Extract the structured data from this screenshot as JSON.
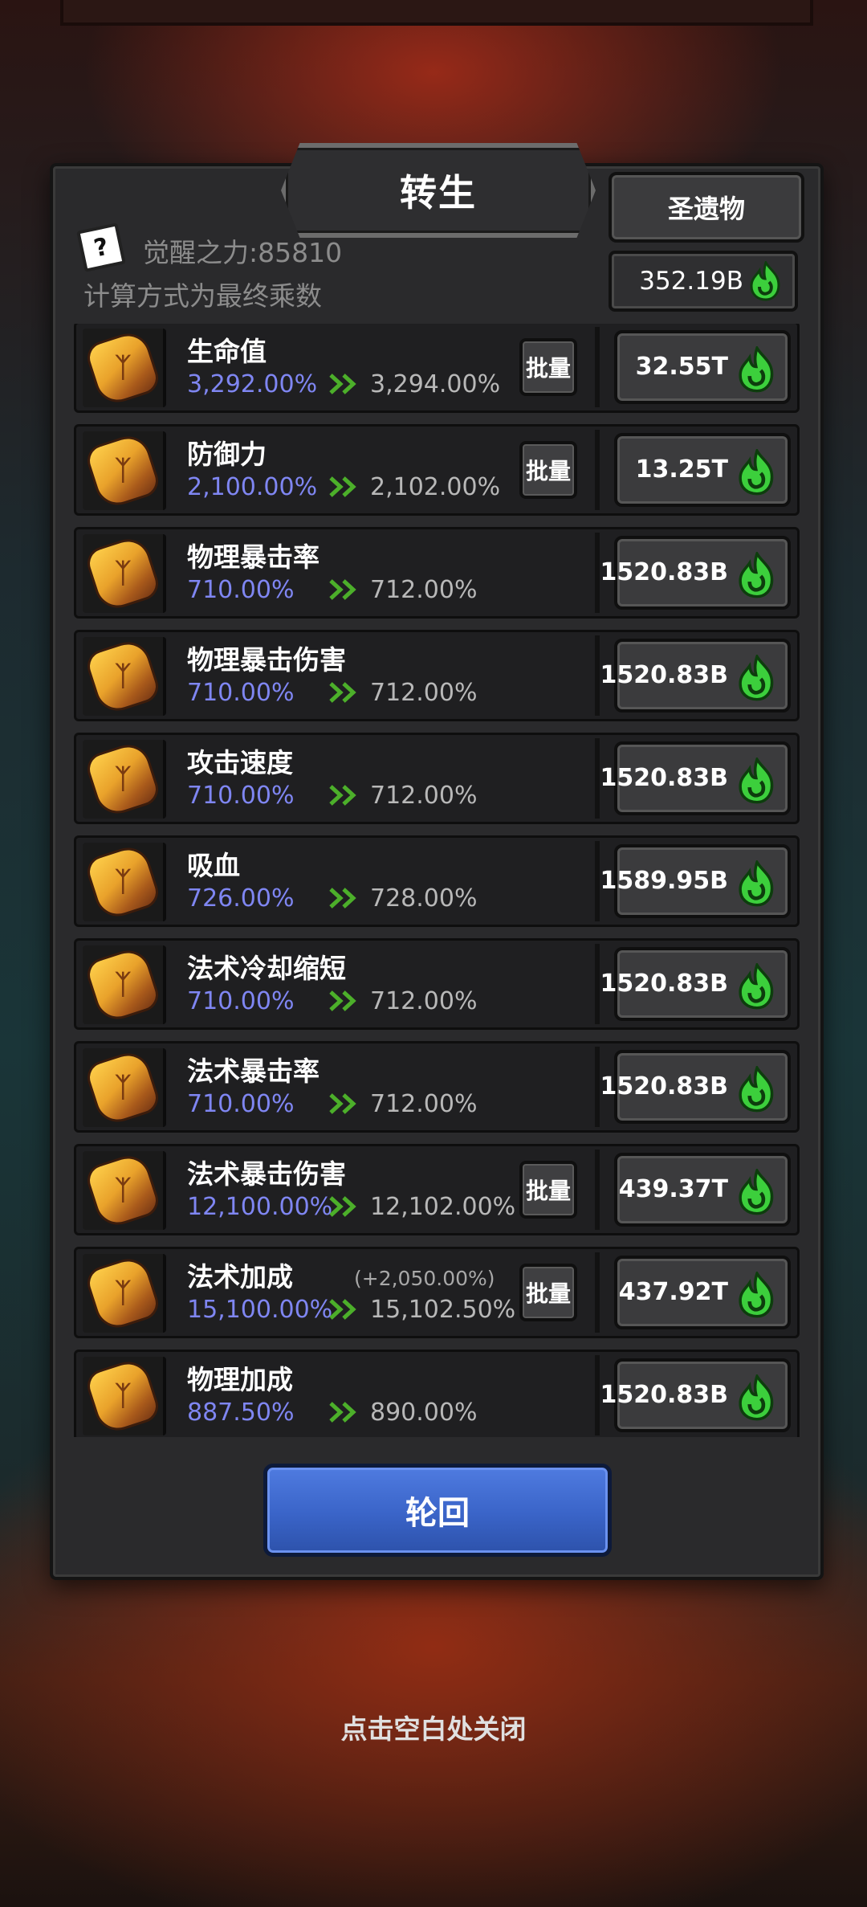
{
  "dialog": {
    "title": "转生",
    "relic_button": "圣遗物",
    "relic_amount": "352.19B",
    "help_icon_glyph": "?",
    "awaken_power": "觉醒之力:85810",
    "calc_note": "计算方式为最终乘数"
  },
  "stats": [
    {
      "name": "生命值",
      "current": "3,292.00%",
      "next": "3,294.00%",
      "batch": "批量",
      "cost": "32.55T"
    },
    {
      "name": "防御力",
      "current": "2,100.00%",
      "next": "2,102.00%",
      "batch": "批量",
      "cost": "13.25T"
    },
    {
      "name": "物理暴击率",
      "current": "710.00%",
      "next": "712.00%",
      "cost": "1520.83B"
    },
    {
      "name": "物理暴击伤害",
      "current": "710.00%",
      "next": "712.00%",
      "cost": "1520.83B"
    },
    {
      "name": "攻击速度",
      "current": "710.00%",
      "next": "712.00%",
      "cost": "1520.83B"
    },
    {
      "name": "吸血",
      "current": "726.00%",
      "next": "728.00%",
      "cost": "1589.95B"
    },
    {
      "name": "法术冷却缩短",
      "current": "710.00%",
      "next": "712.00%",
      "cost": "1520.83B"
    },
    {
      "name": "法术暴击率",
      "current": "710.00%",
      "next": "712.00%",
      "cost": "1520.83B"
    },
    {
      "name": "法术暴击伤害",
      "current": "12,100.00%",
      "next": "12,102.00%",
      "batch": "批量",
      "cost": "439.37T"
    },
    {
      "name": "法术加成",
      "extra": "(+2,050.00%)",
      "current": "15,100.00%",
      "next": "15,102.50%",
      "batch": "批量",
      "cost": "437.92T"
    },
    {
      "name": "物理加成",
      "current": "887.50%",
      "next": "890.00%",
      "cost": "1520.83B"
    }
  ],
  "rebirth_button": "轮回",
  "close_hint": "点击空白处关闭",
  "colors": {
    "current_value": "#7f86f2",
    "arrow": "#4caf2a",
    "flame": "#3ccf3c",
    "rebirth_button": "#3a64c8"
  },
  "icons": {
    "stat": "rune-stone-icon",
    "currency": "green-flame-icon",
    "arrow": "double-chevron-right-icon"
  }
}
